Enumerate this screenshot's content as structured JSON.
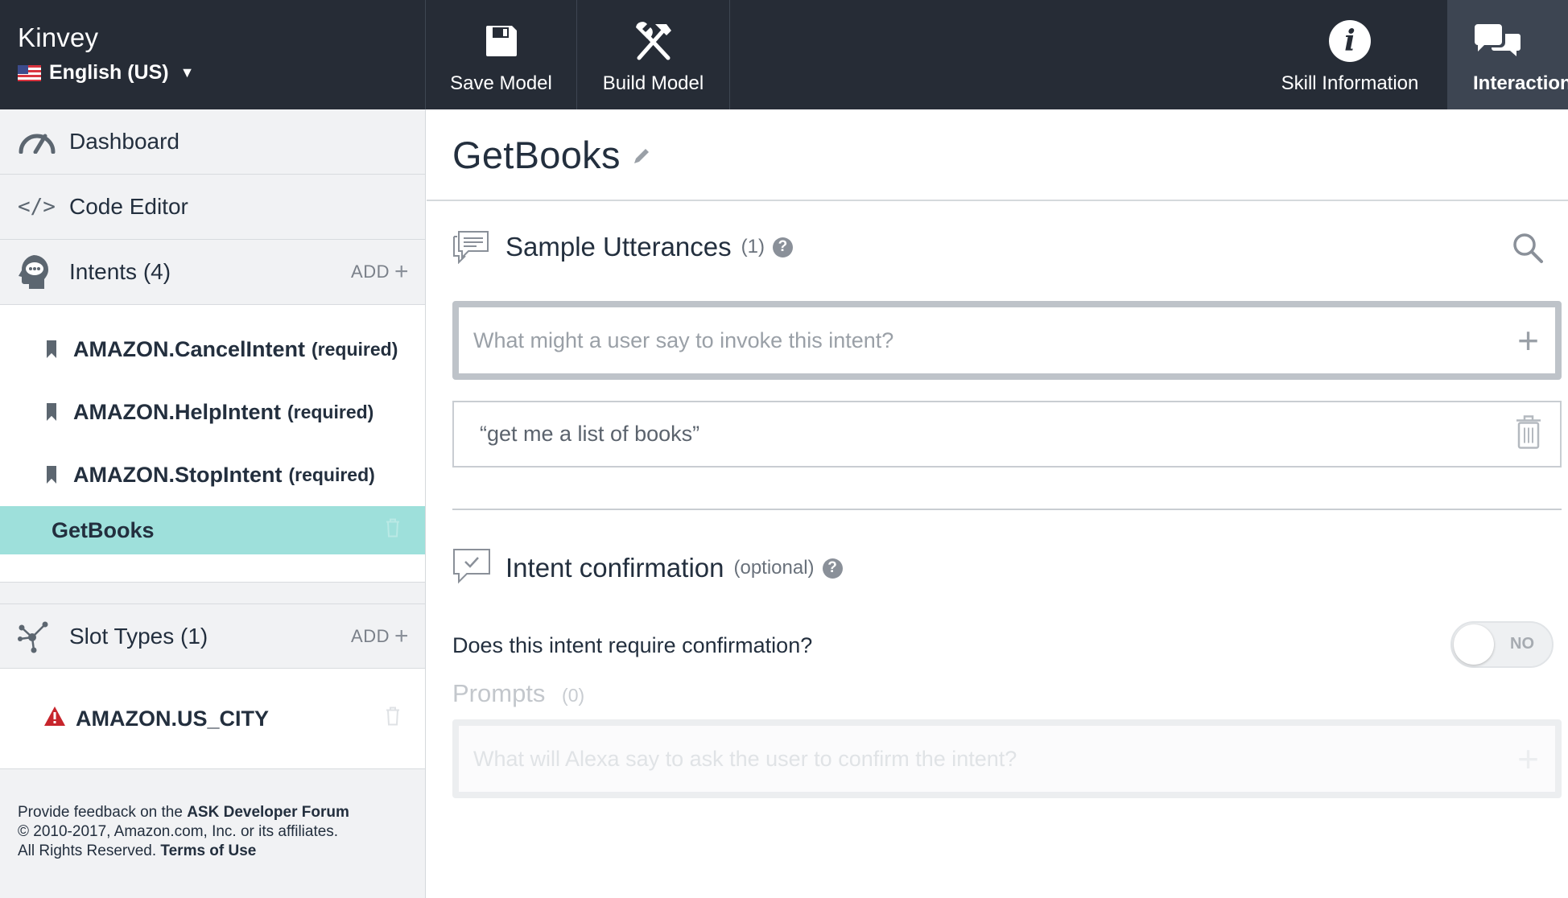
{
  "header": {
    "skill_name": "Kinvey",
    "language": "English (US)",
    "language_caret": "▼",
    "save_label": "Save Model",
    "build_label": "Build Model",
    "info_label": "Skill Information",
    "interaction_label": "Interaction",
    "info_glyph": "i"
  },
  "sidebar": {
    "dashboard": "Dashboard",
    "code_editor": "Code Editor",
    "code_glyph": "</>",
    "intents_label": "Intents (4)",
    "add_label": "ADD",
    "add_plus": "+",
    "intents": [
      {
        "name": "AMAZON.CancelIntent",
        "suffix": "(required)"
      },
      {
        "name": "AMAZON.HelpIntent",
        "suffix": "(required)"
      },
      {
        "name": "AMAZON.StopIntent",
        "suffix": "(required)"
      }
    ],
    "active_intent": "GetBooks",
    "slot_types_label": "Slot Types (1)",
    "slot_types": [
      {
        "name": "AMAZON.US_CITY",
        "status": "warning"
      }
    ]
  },
  "footer": {
    "line1_prefix": "Provide feedback on the ",
    "forum_link": "ASK Developer Forum",
    "line2": "© 2010-2017, Amazon.com, Inc. or its affiliates.",
    "line3_prefix": "All Rights Reserved. ",
    "terms_link": "Terms of Use"
  },
  "main": {
    "intent_title": "GetBooks",
    "utterances": {
      "title": "Sample Utterances",
      "count": "(1)",
      "help": "?",
      "input_placeholder": "What might a user say to invoke this intent?",
      "add_glyph": "+",
      "items": [
        "“get me a list of books”"
      ]
    },
    "confirmation": {
      "title": "Intent confirmation",
      "optional": "(optional)",
      "help": "?",
      "question": "Does this intent require confirmation?",
      "toggle_label": "NO",
      "toggle_on": false
    },
    "prompts": {
      "title": "Prompts",
      "count": "(0)",
      "input_placeholder": "What will Alexa say to ask the user to confirm the intent?",
      "add_glyph": "+"
    }
  },
  "colors": {
    "topbar": "#262c36",
    "active_tab": "#3d4552",
    "sidebar_bg": "#f1f2f4",
    "active_intent": "#9ee0db",
    "warning": "#c7252c"
  },
  "icons": {
    "save": "floppy-disk-icon",
    "build": "hammer-wrench-icon",
    "info": "info-circle-icon",
    "interaction": "chat-bubbles-icon",
    "dashboard": "speedometer-icon",
    "code": "code-brackets-icon",
    "intents": "head-chat-icon",
    "slot_types": "nodes-icon",
    "bookmark": "bookmark-icon",
    "trash": "trash-icon",
    "warning": "warning-triangle-icon",
    "pencil": "pencil-icon",
    "search": "search-icon",
    "utterance": "speech-bubble-lines-icon",
    "confirm": "speech-bubble-check-icon"
  }
}
